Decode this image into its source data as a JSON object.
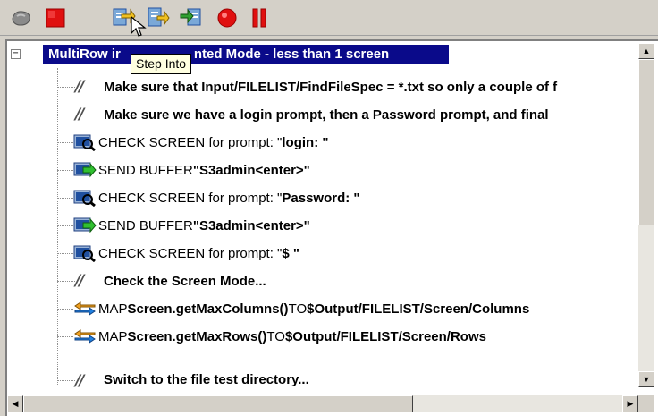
{
  "toolbar": {
    "buttons": [
      {
        "name": "reset-button",
        "icon": "gray-shape-icon"
      },
      {
        "name": "stop-button",
        "icon": "red-square-icon"
      },
      {
        "name": "step-into-button",
        "icon": "step-into-icon"
      },
      {
        "name": "step-over-button",
        "icon": "step-over-icon"
      },
      {
        "name": "step-out-button",
        "icon": "step-out-icon"
      },
      {
        "name": "record-button",
        "icon": "red-circle-icon"
      },
      {
        "name": "pause-button",
        "icon": "pause-icon"
      }
    ],
    "tooltip": "Step Into"
  },
  "tree": {
    "expander": "−",
    "root_label": "MultiRow in Formatted Mode - less than 1 screen",
    "root_label_visible_left": "MultiRow ir",
    "root_label_visible_right": "nted Mode - less than 1 screen",
    "rows": [
      {
        "type": "comment",
        "text": "Make sure that Input/FILELIST/FindFileSpec = *.txt so only a couple of f"
      },
      {
        "type": "comment",
        "text": "Make sure we have a login prompt, then a Password prompt, and final"
      },
      {
        "type": "check",
        "prefix": "CHECK SCREEN for prompt: \"",
        "value": "login: \"",
        "icon": "check-screen-icon"
      },
      {
        "type": "send",
        "prefix": "SEND BUFFER ",
        "value": "\"S3admin<enter>\"",
        "icon": "send-buffer-icon"
      },
      {
        "type": "check",
        "prefix": "CHECK SCREEN for prompt: \"",
        "value": "Password: \"",
        "icon": "check-screen-icon"
      },
      {
        "type": "send",
        "prefix": "SEND BUFFER ",
        "value": "\"S3admin<enter>\"",
        "icon": "send-buffer-icon"
      },
      {
        "type": "check",
        "prefix": "CHECK SCREEN for prompt: \"",
        "value": "$ \"",
        "icon": "check-screen-icon"
      },
      {
        "type": "comment",
        "text": "Check the Screen Mode..."
      },
      {
        "type": "map",
        "prefix": "MAP ",
        "value": "Screen.getMaxColumns()",
        "mid": " TO ",
        "target": "$Output/FILELIST/Screen/Columns",
        "icon": "map-icon"
      },
      {
        "type": "map",
        "prefix": "MAP ",
        "value": "Screen.getMaxRows()",
        "mid": " TO ",
        "target": "$Output/FILELIST/Screen/Rows",
        "icon": "map-icon"
      },
      {
        "type": "comment",
        "text": "Switch to the file test directory..."
      }
    ]
  },
  "colors": {
    "selection": "#0a0a8a",
    "tooltip_bg": "#ffffe1",
    "window_bg": "#d4d0c8"
  }
}
